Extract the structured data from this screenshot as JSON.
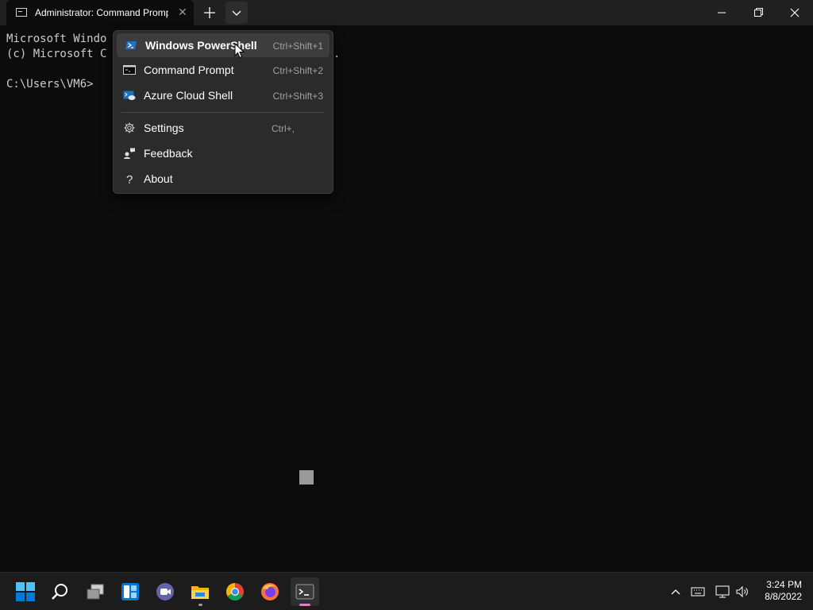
{
  "window": {
    "tab_title": "Administrator: Command Prompt",
    "tab_close_glyph": "✕",
    "new_tab_icon": "plus-icon",
    "dropdown_icon": "chevron-down-icon",
    "controls": [
      "minimize-icon",
      "maximize-icon",
      "close-icon"
    ]
  },
  "terminal": {
    "lines": [
      "Microsoft Windo",
      "(c) Microsoft C",
      "",
      "C:\\Users\\VM6>"
    ],
    "trailing_dot": "."
  },
  "menu": {
    "profiles": [
      {
        "label": "Windows PowerShell",
        "shortcut": "Ctrl+Shift+1",
        "icon": "powershell-icon"
      },
      {
        "label": "Command Prompt",
        "shortcut": "Ctrl+Shift+2",
        "icon": "cmd-icon"
      },
      {
        "label": "Azure Cloud Shell",
        "shortcut": "Ctrl+Shift+3",
        "icon": "azure-cloud-shell-icon"
      }
    ],
    "actions": [
      {
        "label": "Settings",
        "shortcut": "Ctrl+,",
        "icon": "gear-icon"
      },
      {
        "label": "Feedback",
        "shortcut": "",
        "icon": "feedback-icon"
      },
      {
        "label": "About",
        "shortcut": "",
        "icon": "question-icon"
      }
    ]
  },
  "taskbar": {
    "apps": [
      "start-icon",
      "search-icon",
      "task-view-icon",
      "widgets-icon",
      "teams-chat-icon",
      "file-explorer-icon",
      "chrome-icon",
      "firefox-icon",
      "terminal-icon"
    ],
    "tray": [
      "chevron-up-icon",
      "keyboard-icon",
      "network-icon",
      "volume-icon"
    ],
    "time": "3:24 PM",
    "date": "8/8/2022"
  },
  "colors": {
    "accent": "#0078d4",
    "terminal_bg": "#0c0c0c",
    "menu_bg": "#2b2b2b"
  }
}
